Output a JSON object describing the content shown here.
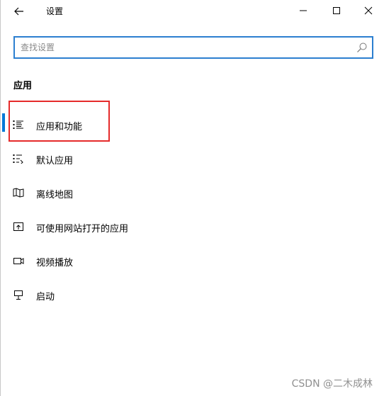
{
  "window": {
    "title": "设置"
  },
  "search": {
    "placeholder": "查找设置",
    "value": ""
  },
  "section": {
    "heading": "应用"
  },
  "nav": {
    "items": [
      {
        "label": "应用和功能",
        "icon": "apps-list-icon",
        "active": true
      },
      {
        "label": "默认应用",
        "icon": "default-apps-icon",
        "active": false
      },
      {
        "label": "离线地图",
        "icon": "map-icon",
        "active": false
      },
      {
        "label": "可使用网站打开的应用",
        "icon": "open-in-icon",
        "active": false
      },
      {
        "label": "视频播放",
        "icon": "video-icon",
        "active": false
      },
      {
        "label": "启动",
        "icon": "startup-icon",
        "active": false
      }
    ]
  },
  "watermark": {
    "text": "CSDN @二木成林"
  },
  "colors": {
    "accent": "#0078d7",
    "search_border": "#2c7fd0",
    "highlight": "#e52b2b"
  }
}
